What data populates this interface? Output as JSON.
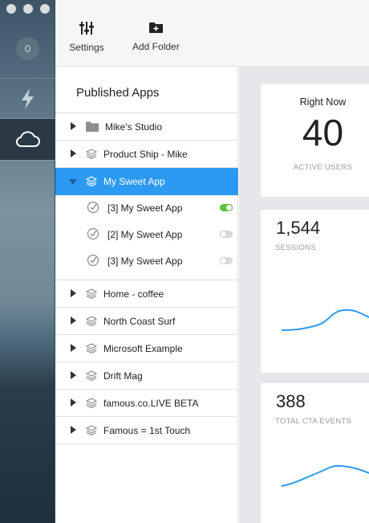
{
  "window": {
    "traffic_light_color": "#d9dde0"
  },
  "rail": {
    "count": "0",
    "items": [
      "bolt-icon",
      "cloud-icon"
    ],
    "active_item": "cloud-icon"
  },
  "toolbar": {
    "settings_label": "Settings",
    "add_folder_label": "Add Folder"
  },
  "apps": {
    "title": "Published Apps",
    "selection_color": "#2c9af3",
    "items": [
      {
        "label": "Mike's Studio",
        "icon": "folder-icon",
        "expanded": false
      },
      {
        "label": "Product Ship - Mike",
        "icon": "stack-icon",
        "expanded": false
      },
      {
        "label": "My Sweet App",
        "icon": "stack-icon",
        "expanded": true,
        "selected": true
      },
      {
        "label": "Home - coffee",
        "icon": "stack-icon",
        "expanded": false
      },
      {
        "label": "North Coast Surf",
        "icon": "stack-icon",
        "expanded": false
      },
      {
        "label": "Microsoft Example",
        "icon": "stack-icon",
        "expanded": false
      },
      {
        "label": "Drift Mag",
        "icon": "stack-icon",
        "expanded": false
      },
      {
        "label": "famous.co.LIVE BETA",
        "icon": "stack-icon",
        "expanded": false
      },
      {
        "label": "Famous = 1st Touch",
        "icon": "stack-icon",
        "expanded": false
      }
    ],
    "versions": [
      {
        "label": "[3] My Sweet App",
        "published": true
      },
      {
        "label": "[2] My Sweet App",
        "published": false
      },
      {
        "label": "[3] My Sweet App",
        "published": false
      }
    ]
  },
  "stats": {
    "right_now": {
      "heading": "Right Now",
      "value": "40",
      "caption": "ACTIVE USERS"
    },
    "sessions": {
      "value": "1,544",
      "caption": "SESSIONS"
    },
    "cta": {
      "value": "388",
      "caption": "TOTAL CTA EVENTS"
    },
    "line_color": "#2c9af3"
  }
}
